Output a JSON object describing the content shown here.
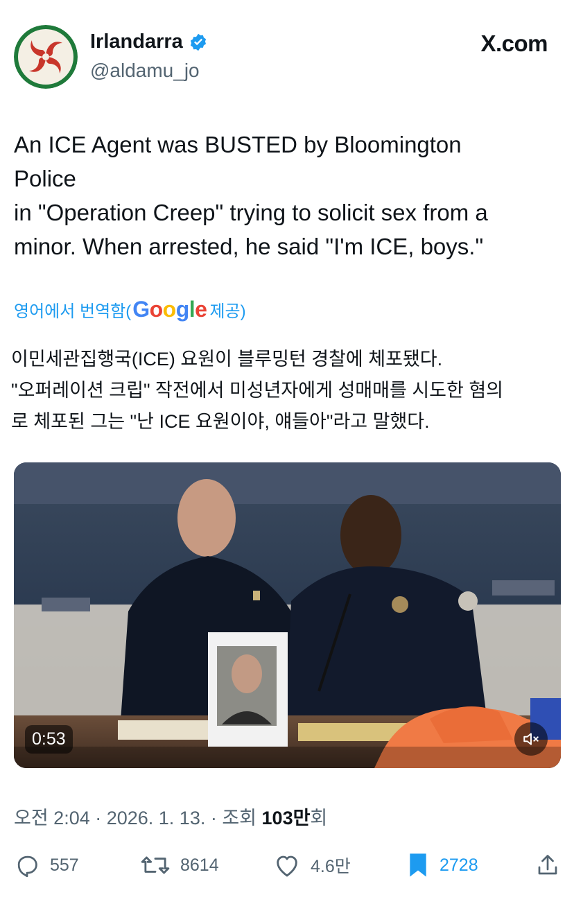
{
  "author": {
    "display_name": "Irlandarra",
    "handle": "@aldamu_jo",
    "verified": true,
    "avatar_icon": "lauburu-emblem-icon"
  },
  "brand": {
    "label": "X.com"
  },
  "tweet": {
    "lines": [
      "An ICE Agent was BUSTED by Bloomington",
      "Police",
      "in \"Operation Creep\" trying to solicit sex from a",
      "minor. When arrested, he said \"I'm ICE, boys.\""
    ]
  },
  "translation": {
    "link_prefix": "영어에서 번역함(",
    "provider": "Google",
    "link_suffix": " 제공)",
    "lines": [
      "이민세관집행국(ICE) 요원이 블루밍턴 경찰에 체포됐다.",
      "\"오퍼레이션 크립\" 작전에서 미성년자에게 성매매를 시도한 혐의",
      "로 체포된 그는 \"난 ICE 요원이야, 얘들아\"라고 말했다."
    ]
  },
  "video": {
    "duration": "0:53",
    "muted": true
  },
  "meta": {
    "prefix": "오전 2:04 · 2026. 1. 13. · 조회 ",
    "views": "103만",
    "suffix": "회"
  },
  "actions": {
    "replies": "557",
    "reposts": "8614",
    "likes": "4.6만",
    "bookmarks": "2728"
  },
  "colors": {
    "accent": "#1d9bf0",
    "secondary_text": "#536471",
    "primary_text": "#0f1419"
  }
}
